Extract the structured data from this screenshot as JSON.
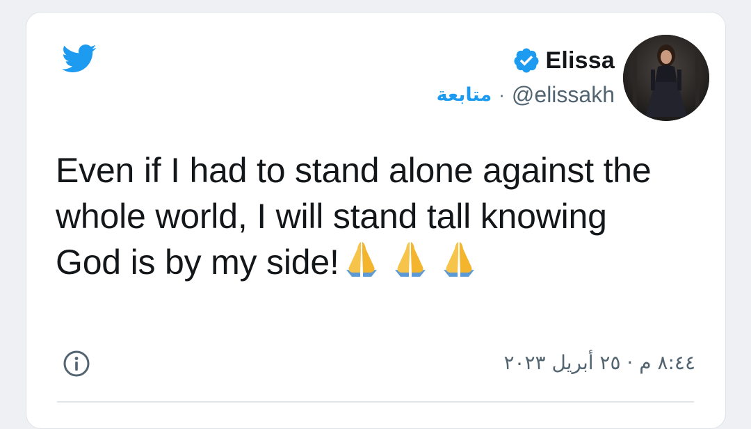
{
  "tweet": {
    "author": {
      "display_name": "Elissa",
      "handle": "@elissakh",
      "follow_label": "متابعة",
      "separator": "·",
      "verified": true,
      "avatar": "profile-photo"
    },
    "text": "Even if I had to stand alone against the whole world, I will stand tall knowing God is by my side!",
    "emoji": [
      "folded-hands",
      "folded-hands",
      "folded-hands"
    ],
    "timestamp": "٨:٤٤ م · ٢٥ أبريل ٢٠٢٣",
    "icons": {
      "brand": "twitter-bird-icon",
      "info": "info-icon",
      "verified": "verified-badge-icon"
    }
  },
  "colors": {
    "twitter_blue": "#1d9bf0",
    "text_primary": "#14171a",
    "text_secondary": "#536471",
    "background": "#eef0f3",
    "card": "#ffffff"
  }
}
